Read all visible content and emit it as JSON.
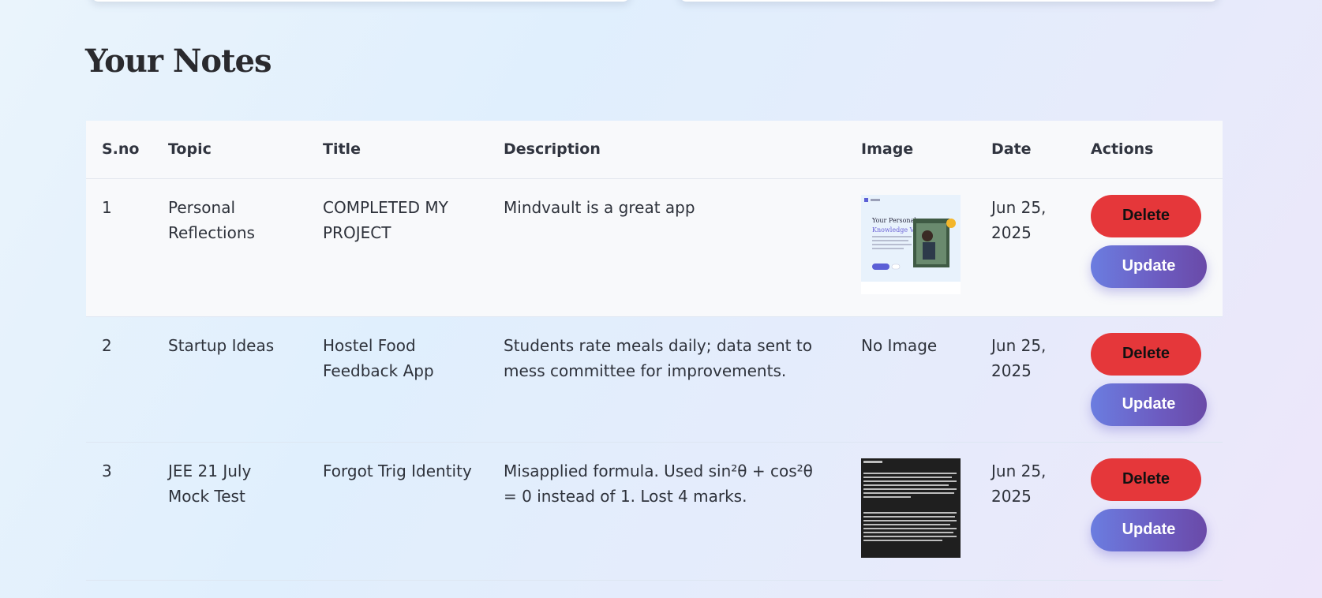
{
  "page": {
    "title": "Your Notes"
  },
  "table": {
    "headers": [
      "S.no",
      "Topic",
      "Title",
      "Description",
      "Image",
      "Date",
      "Actions"
    ],
    "rows": [
      {
        "sno": "1",
        "topic": "Personal Reflections",
        "title": "COMPLETED MY PROJECT",
        "description": "Mindvault is a great app",
        "image": "thumbnail",
        "image_thumb_text": {
          "heading1": "Your Personal",
          "heading2": "Knowledge Vault"
        },
        "date": "Jun 25, 2025",
        "delete_label": "Delete",
        "update_label": "Update"
      },
      {
        "sno": "2",
        "topic": "Startup Ideas",
        "title": "Hostel Food Feedback App",
        "description": "Students rate meals daily; data sent to mess committee for improvements.",
        "image": "No Image",
        "date": "Jun 25, 2025",
        "delete_label": "Delete",
        "update_label": "Update"
      },
      {
        "sno": "3",
        "topic": "JEE 21 July Mock Test",
        "title": "Forgot Trig Identity",
        "description": "Misapplied formula. Used sin²θ + cos²θ = 0 instead of 1. Lost 4 marks.",
        "image": "thumbnail",
        "date": "Jun 25, 2025",
        "delete_label": "Delete",
        "update_label": "Update"
      }
    ]
  },
  "colors": {
    "delete": "#e5373a",
    "update_start": "#6b7de0",
    "update_end": "#6a4aa8",
    "row_light": "#f8f9fb"
  }
}
